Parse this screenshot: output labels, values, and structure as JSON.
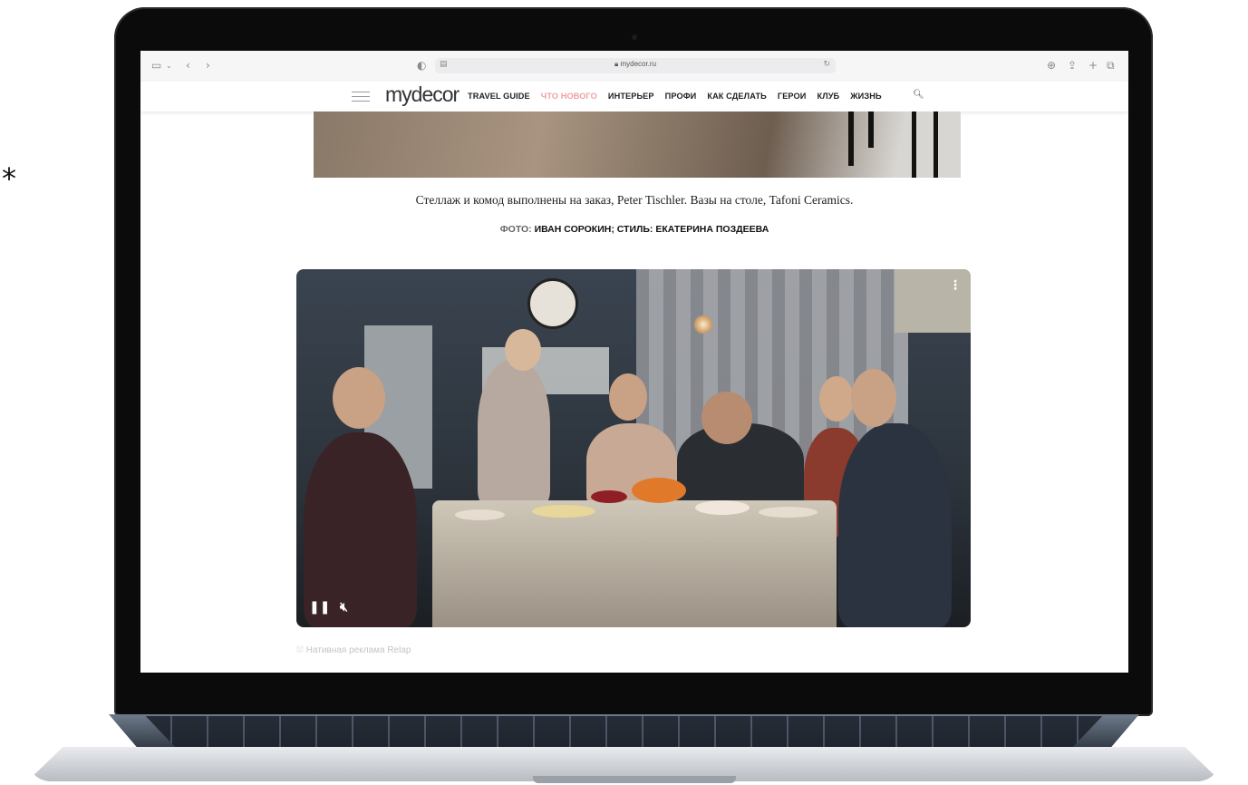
{
  "decor": {
    "asterisk": "*"
  },
  "browser": {
    "url": "mydecor.ru",
    "icons": [
      "sidebar-icon",
      "back-icon",
      "forward-icon",
      "shield-icon",
      "reader-icon",
      "lock-icon",
      "reload-icon",
      "download-icon",
      "share-icon",
      "new-tab-icon",
      "tabs-icon"
    ]
  },
  "site": {
    "logo": "mydecor",
    "menu": [
      {
        "label": "TRAVEL GUIDE",
        "active": false
      },
      {
        "label": "ЧТО НОВОГО",
        "active": true
      },
      {
        "label": "ИНТЕРЬЕР",
        "active": false
      },
      {
        "label": "ПРОФИ",
        "active": false
      },
      {
        "label": "КАК СДЕЛАТЬ",
        "active": false
      },
      {
        "label": "ГЕРОИ",
        "active": false
      },
      {
        "label": "КЛУБ",
        "active": false
      },
      {
        "label": "ЖИЗНЬ",
        "active": false
      }
    ],
    "accent_color": "#f0a0a0"
  },
  "article": {
    "caption": "Стеллаж и комод выполнены на заказ, Peter Tischler. Вазы на столе, Tafoni Ceramics.",
    "credit_label": "ФОТО:",
    "credit_names": "ИВАН СОРОКИН; СТИЛЬ: ЕКАТЕРИНА ПОЗДЕЕВА"
  },
  "video": {
    "controls": {
      "pause": "❚❚",
      "mute": "🔇︎",
      "more": "⋮"
    }
  },
  "ad": {
    "note": "Нативная реклама Relap"
  }
}
